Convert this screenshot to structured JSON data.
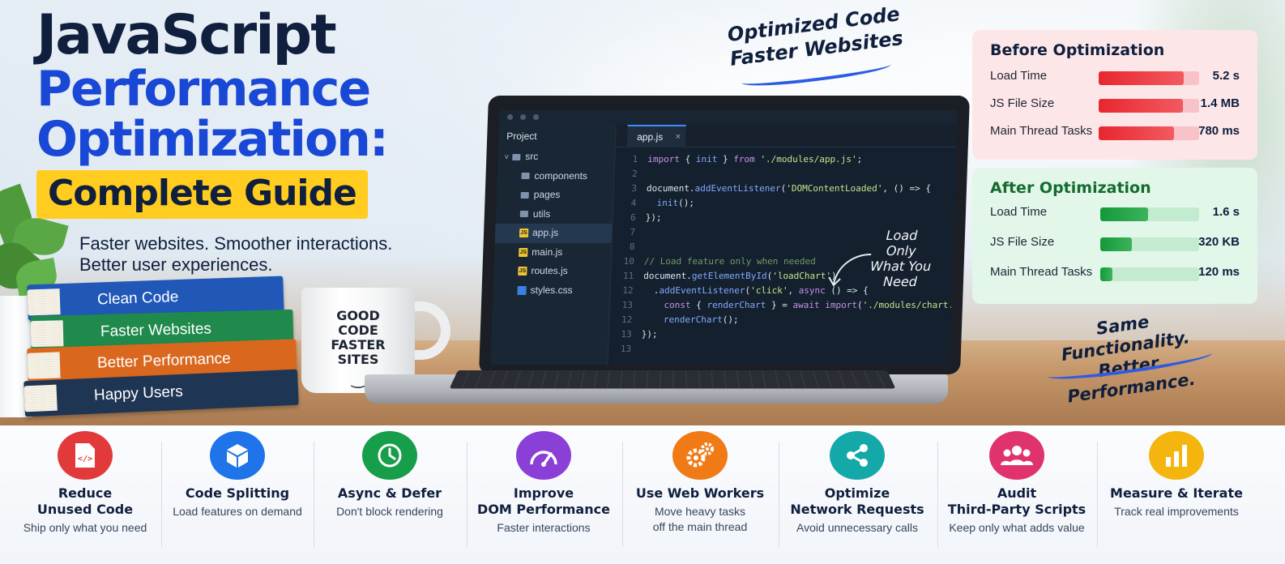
{
  "title": {
    "line1": "JavaScript",
    "line2": "Performance",
    "line3": "Optimization:",
    "highlight": "Complete Guide"
  },
  "tagline": {
    "line1": "Faster websites. Smoother interactions.",
    "line2": "Better user experiences."
  },
  "books": [
    {
      "label": "Clean Code",
      "color": "#2158b8"
    },
    {
      "label": "Faster Websites",
      "color": "#1f8a4c"
    },
    {
      "label": "Better Performance",
      "color": "#d9681e"
    },
    {
      "label": "Happy Users",
      "color": "#1f3554"
    }
  ],
  "mug": {
    "line1": "GOOD",
    "line2": "CODE",
    "line3": "FASTER",
    "line4": "SITES",
    "smile": "‿"
  },
  "editor": {
    "project_label": "Project",
    "tab_label": "app.js",
    "tab_close": "×",
    "tree": [
      {
        "label": "src",
        "kind": "folder",
        "indent": 0,
        "chevron": "˅"
      },
      {
        "label": "components",
        "kind": "folder",
        "indent": 1
      },
      {
        "label": "pages",
        "kind": "folder",
        "indent": 1
      },
      {
        "label": "utils",
        "kind": "folder",
        "indent": 1
      },
      {
        "label": "app.js",
        "kind": "js",
        "indent": 1,
        "active": true
      },
      {
        "label": "main.js",
        "kind": "js",
        "indent": 1
      },
      {
        "label": "routes.js",
        "kind": "js",
        "indent": 1
      },
      {
        "label": "styles.css",
        "kind": "css",
        "indent": 1
      }
    ],
    "js_badge": "JS",
    "code": [
      {
        "n": "1",
        "t": "import { init } from './modules/app.js';"
      },
      {
        "n": "2",
        "t": ""
      },
      {
        "n": "3",
        "t": "document.addEventListener('DOMContentLoaded', () => {"
      },
      {
        "n": "4",
        "t": "  init();"
      },
      {
        "n": "6",
        "t": "});"
      },
      {
        "n": "7",
        "t": ""
      },
      {
        "n": "8",
        "t": ""
      },
      {
        "n": "10",
        "t": "// Load feature only when needed"
      },
      {
        "n": "11",
        "t": "document.getElementById('loadChart')"
      },
      {
        "n": "12",
        "t": "  .addEventListener('click', async () => {"
      },
      {
        "n": "13",
        "t": "    const { renderChart } = await import('./modules/chart.js');"
      },
      {
        "n": "12",
        "t": "    renderChart();"
      },
      {
        "n": "13",
        "t": "});"
      },
      {
        "n": "13",
        "t": ""
      }
    ],
    "annotation": {
      "line1": "Load",
      "line2": "Only",
      "line3": "What You",
      "line4": "Need"
    }
  },
  "handwritten": {
    "top_line1": "Optimized Code",
    "top_line2": "Faster Websites",
    "bottom_line1": "Same Functionality.",
    "bottom_line2": "Better Performance."
  },
  "before": {
    "title": "Before Optimization",
    "metrics": [
      {
        "label": "Load Time",
        "value": "5.2 s",
        "level": 0.85
      },
      {
        "label": "JS File Size",
        "value": "1.4 MB",
        "level": 0.84
      },
      {
        "label": "Main Thread Tasks",
        "value": "780 ms",
        "level": 0.75
      }
    ]
  },
  "after": {
    "title": "After Optimization",
    "metrics": [
      {
        "label": "Load Time",
        "value": "1.6 s",
        "level": 0.48
      },
      {
        "label": "JS File Size",
        "value": "320 KB",
        "level": 0.32
      },
      {
        "label": "Main Thread Tasks",
        "value": "120 ms",
        "level": 0.12
      }
    ]
  },
  "tips": [
    {
      "title": "Reduce\nUnused Code",
      "sub": "Ship only what you need",
      "color": "#e23a3a",
      "icon": "code-file-icon"
    },
    {
      "title": "Code Splitting",
      "sub": "Load features on demand",
      "color": "#1e74e8",
      "icon": "cube-icon"
    },
    {
      "title": "Async & Defer",
      "sub": "Don't block rendering",
      "color": "#169e4a",
      "icon": "clock-icon"
    },
    {
      "title": "Improve\nDOM Performance",
      "sub": "Faster interactions",
      "color": "#8a3fd6",
      "icon": "speedometer-icon"
    },
    {
      "title": "Use Web Workers",
      "sub": "Move heavy tasks\noff the main thread",
      "color": "#f07a16",
      "icon": "gears-icon"
    },
    {
      "title": "Optimize\nNetwork Requests",
      "sub": "Avoid unnecessary calls",
      "color": "#14a9a8",
      "icon": "share-icon"
    },
    {
      "title": "Audit\nThird-Party Scripts",
      "sub": "Keep only what adds value",
      "color": "#e0336d",
      "icon": "users-icon"
    },
    {
      "title": "Measure & Iterate",
      "sub": "Track real improvements",
      "color": "#f5b50f",
      "icon": "bar-chart-icon"
    }
  ]
}
